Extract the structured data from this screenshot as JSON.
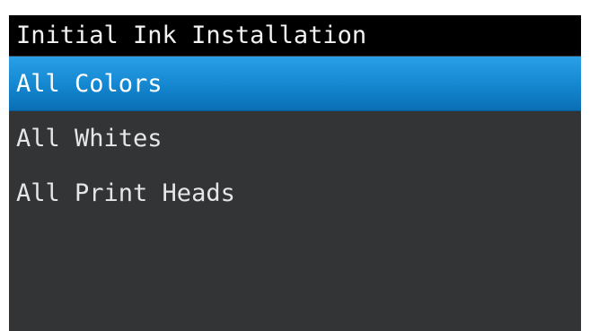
{
  "screen": {
    "title": "Initial Ink Installation",
    "menu": {
      "items": [
        {
          "label": "All Colors"
        },
        {
          "label": "All Whites"
        },
        {
          "label": "All Print Heads"
        }
      ],
      "selected_index": 0
    }
  },
  "colors": {
    "title_bar": "#000000",
    "background": "#323436",
    "highlight": "#1386cf",
    "text": "#e6e6e6"
  }
}
